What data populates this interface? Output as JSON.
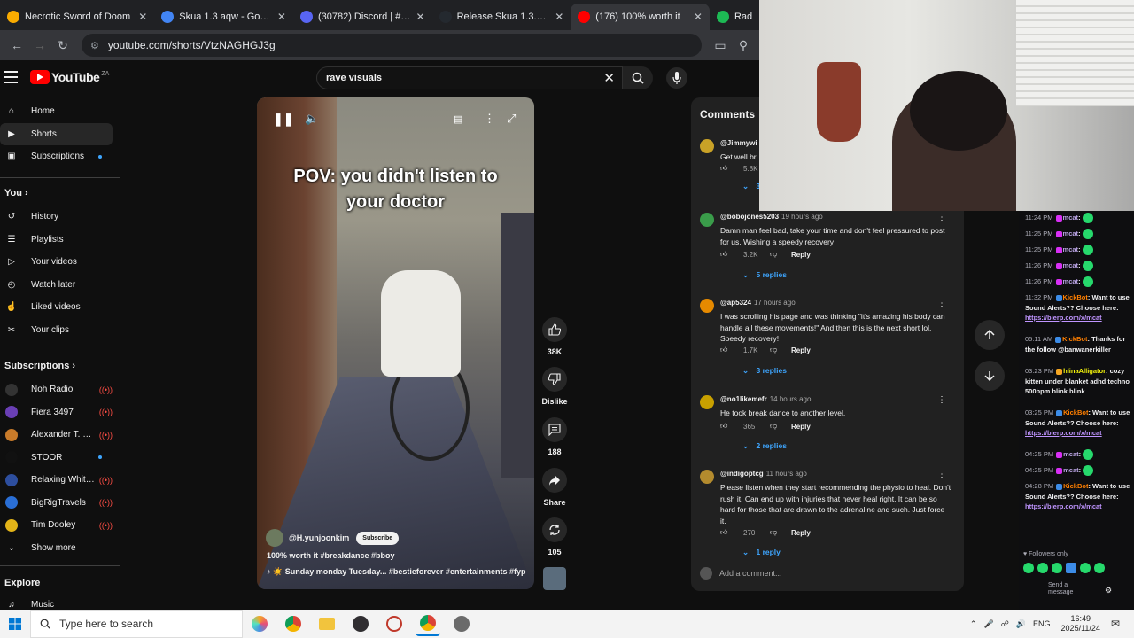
{
  "browser": {
    "tabs": [
      {
        "title": "Necrotic Sword of Doom",
        "color": "#f9ab00",
        "active": false
      },
      {
        "title": "Skua 1.3 aqw - Google S",
        "color": "#4285f4",
        "active": false
      },
      {
        "title": "(30782) Discord | #skua",
        "color": "#5865f2",
        "active": false
      },
      {
        "title": "Release Skua 1.3.0.2 - au",
        "color": "#24292f",
        "active": false
      },
      {
        "title": "(176) 100% worth it",
        "color": "#ff0000",
        "active": true
      },
      {
        "title": "Rad",
        "color": "#1db954",
        "active": false
      }
    ],
    "url": "youtube.com/shorts/VtzNAGHGJ3g"
  },
  "youtube": {
    "logo": "YouTube",
    "country": "ZA",
    "search_value": "rave visuals",
    "sidebar": {
      "main": [
        {
          "label": "Home",
          "icon": "home-icon"
        },
        {
          "label": "Shorts",
          "icon": "shorts-icon"
        },
        {
          "label": "Subscriptions",
          "icon": "subscriptions-icon"
        }
      ],
      "you_heading": "You",
      "you": [
        {
          "label": "History",
          "icon": "history-icon"
        },
        {
          "label": "Playlists",
          "icon": "playlists-icon"
        },
        {
          "label": "Your videos",
          "icon": "your-videos-icon"
        },
        {
          "label": "Watch later",
          "icon": "watch-later-icon"
        },
        {
          "label": "Liked videos",
          "icon": "liked-videos-icon"
        },
        {
          "label": "Your clips",
          "icon": "clips-icon"
        }
      ],
      "subs_heading": "Subscriptions",
      "subscriptions": [
        {
          "label": "Noh Radio",
          "color": "#333333",
          "live": true
        },
        {
          "label": "Fiera 3497",
          "color": "#6a3fb5",
          "live": true
        },
        {
          "label": "Alexander T. Rose",
          "color": "#c97b2a",
          "live": true
        },
        {
          "label": "STOOR",
          "color": "#111111",
          "live": false
        },
        {
          "label": "Relaxing White N...",
          "color": "#2d4e9e",
          "live": true
        },
        {
          "label": "BigRigTravels",
          "color": "#2a6fd6",
          "live": true
        },
        {
          "label": "Tim Dooley",
          "color": "#e3b418",
          "live": true
        }
      ],
      "show_more": "Show more",
      "explore_heading": "Explore",
      "explore": [
        {
          "label": "Music",
          "icon": "music-icon"
        }
      ]
    },
    "video": {
      "caption_line1": "POV: you didn't listen to",
      "caption_line2": "your doctor",
      "channel": "@H.yunjoonkim",
      "subscribe": "Subscribe",
      "title": "100% worth it #breakdance #bboy",
      "music": "♪ ☀️ Sunday monday Tuesday... #bestieforever #entertainments #fyp"
    },
    "actions": {
      "likes": "38K",
      "dislike": "Dislike",
      "comments": "188",
      "share": "Share",
      "remix": "105"
    },
    "comments_panel": {
      "heading": "Comments",
      "add_placeholder": "Add a comment...",
      "items": [
        {
          "user": "@Jimmywi",
          "ago": "",
          "text": "Get well br",
          "likes": "5.8K",
          "replies": "3 r",
          "color": "#c9a227"
        },
        {
          "user": "@bobojones5203",
          "ago": "19 hours ago",
          "text": "Damn man feel bad, take your time and don't feel pressured to post for us. Wishing a speedy recovery",
          "likes": "3.2K",
          "replies": "5 replies",
          "color": "#3a9c4a"
        },
        {
          "user": "@ap5324",
          "ago": "17 hours ago",
          "text": "I was scrolling his page and was thinking \"it's amazing his body can handle all these movements!\" And then this is the next short lol. Speedy recovery!",
          "likes": "1.7K",
          "replies": "3 replies",
          "color": "#e68a00"
        },
        {
          "user": "@no1likemefr",
          "ago": "14 hours ago",
          "text": "He took break dance to another level.",
          "likes": "365",
          "replies": "2 replies",
          "color": "#c8a000"
        },
        {
          "user": "@indigoptcg",
          "ago": "11 hours ago",
          "text": "Please listen when they start recommending the physio to heal. Don't rush it. Can end up with injuries that never heal right. It can be so hard for those that are drawn to the adrenaline and such. Just force it.",
          "likes": "270",
          "replies": "1 reply",
          "color": "#b38b2e"
        }
      ],
      "reply_label": "Reply"
    }
  },
  "chat": {
    "lines": [
      {
        "time": "11:24 PM",
        "user": "mcat",
        "kind": "mcat",
        "msg": ""
      },
      {
        "time": "11:25 PM",
        "user": "mcat",
        "kind": "mcat",
        "msg": ""
      },
      {
        "time": "11:25 PM",
        "user": "mcat",
        "kind": "mcat",
        "msg": ""
      },
      {
        "time": "11:26 PM",
        "user": "mcat",
        "kind": "mcat",
        "msg": ""
      },
      {
        "time": "11:26 PM",
        "user": "mcat",
        "kind": "mcat",
        "msg": ""
      },
      {
        "time": "11:32 PM",
        "user": "KickBot",
        "kind": "kb",
        "msg": "Want to use Sound Alerts?? Choose here:",
        "link": "https://bierp.com/x/mcat"
      },
      {
        "time": "05:11 AM",
        "user": "KickBot",
        "kind": "kb",
        "msg": "Thanks for the follow @banwanerkiller",
        "link": ""
      },
      {
        "time": "03:23 PM",
        "user": "hlinaAlligator",
        "kind": "hl",
        "msg": "cozy kitten under blanket adhd techno 500bpm blink blink",
        "link": ""
      },
      {
        "time": "03:25 PM",
        "user": "KickBot",
        "kind": "kb",
        "msg": "Want to use Sound Alerts?? Choose here:",
        "link": "https://bierp.com/x/mcat"
      },
      {
        "time": "04:25 PM",
        "user": "mcat",
        "kind": "mcat",
        "msg": ""
      },
      {
        "time": "04:25 PM",
        "user": "mcat",
        "kind": "mcat",
        "msg": ""
      },
      {
        "time": "04:28 PM",
        "user": "KickBot",
        "kind": "kb",
        "msg": "Want to use Sound Alerts?? Choose here:",
        "link": "https://bierp.com/x/mcat"
      }
    ],
    "followers_only": "Followers only",
    "send_placeholder": "Send a message"
  },
  "taskbar": {
    "search_placeholder": "Type here to search",
    "lang": "ENG",
    "time": "16:49",
    "date": "2025/11/24"
  }
}
